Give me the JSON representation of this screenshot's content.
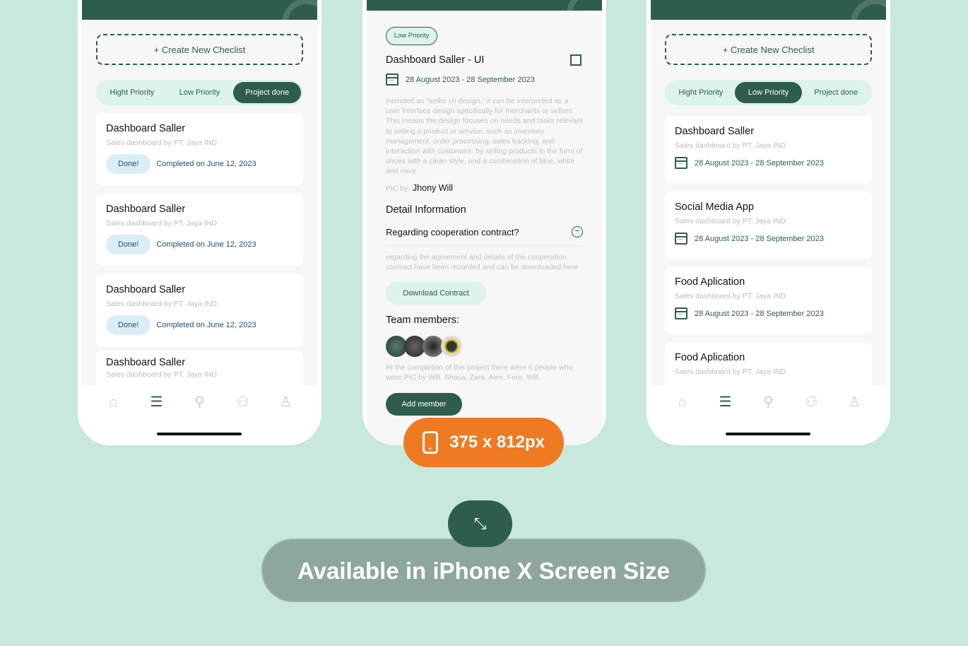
{
  "left_phone": {
    "create_label": "+ Create New Checlist",
    "tabs": [
      "Hight Priority",
      "Low Priority",
      "Project done"
    ],
    "active_tab": "Project done",
    "cards": [
      {
        "title": "Dashboard Saller",
        "subtitle": "Sales dashboard by PT. Jaya IND",
        "status": "Done!",
        "completed": "Completed on June 12, 2023"
      },
      {
        "title": "Dashboard Saller",
        "subtitle": "Sales dashboard by PT. Jaya IND",
        "status": "Done!",
        "completed": "Completed on June 12, 2023"
      },
      {
        "title": "Dashboard Saller",
        "subtitle": "Sales dashboard by PT. Jaya IND",
        "status": "Done!",
        "completed": "Completed on June 12, 2023"
      },
      {
        "title": "Dashboard Saller",
        "subtitle": "Sales dashboard by PT. Jaya IND"
      }
    ]
  },
  "middle_phone": {
    "badge": "Low Priority",
    "title": "Dashboard Saller - UI",
    "date": "28 August 2023 - 28 September 2023",
    "description": "intended as \"seller UI design,\" it can be interpreted as a user interface design specifically for merchants or sellers. This means the design focuses on needs and tasks relevant to selling a product or service, such as inventory management, order processing, sales tracking, and interaction with customers. by selling products in the form of shoes with a clean style, and a combination of blue, white and navy",
    "pic_label": "PIC by:",
    "pic_name": "Jhony Will",
    "detail_heading": "Detail Information",
    "question": "Regarding cooperation contract?",
    "answer": "regarding the agreement and details of the cooperation contract have been recorded and can be downloaded here",
    "download_label": "Download Contract",
    "team_heading": "Team members:",
    "team_note": "At the completion of this project there were 6 people who were PIC by Will. Shasa, Zara, Alex, Fero, Will.",
    "add_member_label": "Add member"
  },
  "right_phone": {
    "create_label": "+ Create New Checlist",
    "tabs": [
      "Hight Priority",
      "Low Priority",
      "Project done"
    ],
    "active_tab": "Low Priority",
    "cards": [
      {
        "title": "Dashboard Saller",
        "subtitle": "Sales dashboard by PT. Jaya IND",
        "date": "28 August 2023 - 28 September 2023"
      },
      {
        "title": "Social Media App",
        "subtitle": "Sales dashboard by PT. Jaya IND",
        "date": "28 August 2023 - 28 September 2023"
      },
      {
        "title": "Food Aplication",
        "subtitle": "Sales dashboard by PT. Jaya IND",
        "date": "28 August 2023 - 28 September 2023"
      },
      {
        "title": "Food Aplication",
        "subtitle": "Sales dashboard by PT. Jaya IND"
      }
    ]
  },
  "nav_icons": [
    "home-icon",
    "list-icon",
    "search-icon",
    "team-icon",
    "profile-icon"
  ],
  "size_badge": "375 x 812px",
  "banner": "Available in iPhone X Screen Size",
  "colors": {
    "primary": "#2e5e4a",
    "accent": "#f07a22",
    "background": "#c7e8db"
  }
}
